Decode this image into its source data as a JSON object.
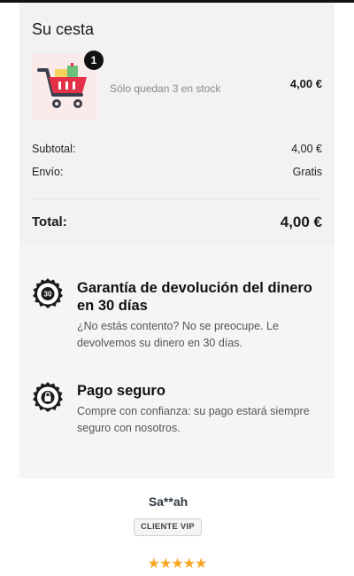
{
  "cart": {
    "title": "Su cesta",
    "item": {
      "quantity": "1",
      "stock_note": "Sólo quedan 3 en stock",
      "price": "4,00 €",
      "icon": "shopping-cart-with-gifts-icon"
    },
    "subtotal_label": "Subtotal:",
    "subtotal_value": "4,00 €",
    "shipping_label": "Envío:",
    "shipping_value": "Gratis",
    "total_label": "Total:",
    "total_value": "4,00 €"
  },
  "benefits": [
    {
      "icon": "money-back-guarantee-seal-icon",
      "seal_text": "30",
      "title": "Garantía de devolución del dinero en 30 días",
      "text": "¿No estás contento? No se preocupe. Le devolvemos su dinero en 30 días."
    },
    {
      "icon": "secure-checkout-lock-seal-icon",
      "title": "Pago seguro",
      "text": "Compre con confianza: su pago estará siempre seguro con nosotros."
    }
  ],
  "review": {
    "name": "Sa**ah",
    "badge": "CLIENTE VIP",
    "rating": 5,
    "stars": "★★★★★"
  },
  "colors": {
    "panel": "#f5f5f5",
    "star": "#f5a623",
    "cart_red": "#e5304a"
  }
}
